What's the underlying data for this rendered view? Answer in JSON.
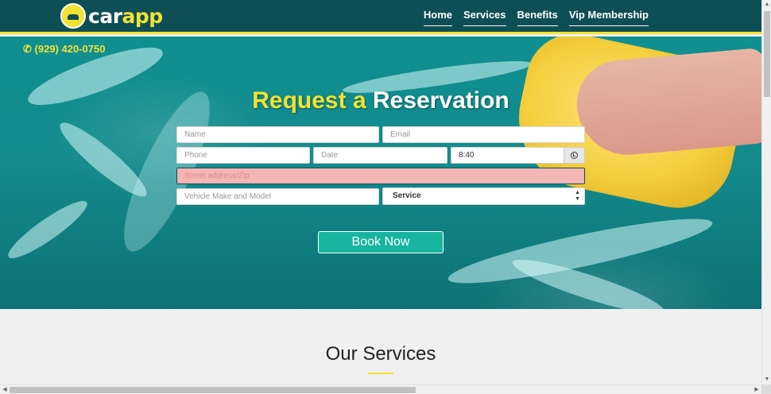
{
  "brand": {
    "name_part1": "car",
    "name_part2": "app"
  },
  "nav": {
    "items": [
      {
        "label": "Home"
      },
      {
        "label": "Services"
      },
      {
        "label": "Benefits"
      },
      {
        "label": "Vip Membership"
      }
    ]
  },
  "contact": {
    "phone_icon": "phone-icon",
    "phone": "(929) 420-0750"
  },
  "hero": {
    "title_accent": "Request a",
    "title_main": "Reservation",
    "form": {
      "name_placeholder": "Name",
      "email_placeholder": "Email",
      "phone_placeholder": "Phone",
      "date_placeholder": "Date",
      "time_value": "8:40",
      "time_icon": "clock-icon",
      "address_placeholder": "Street address/Zip",
      "vehicle_placeholder": "Vehicle Make and Model",
      "service_selected": "Service"
    },
    "book_label": "Book Now"
  },
  "services": {
    "title": "Our Services"
  },
  "colors": {
    "accent": "#f2e233",
    "nav_bg": "#0d4f55",
    "button": "#17b5a0",
    "hero": "#138b8d"
  }
}
